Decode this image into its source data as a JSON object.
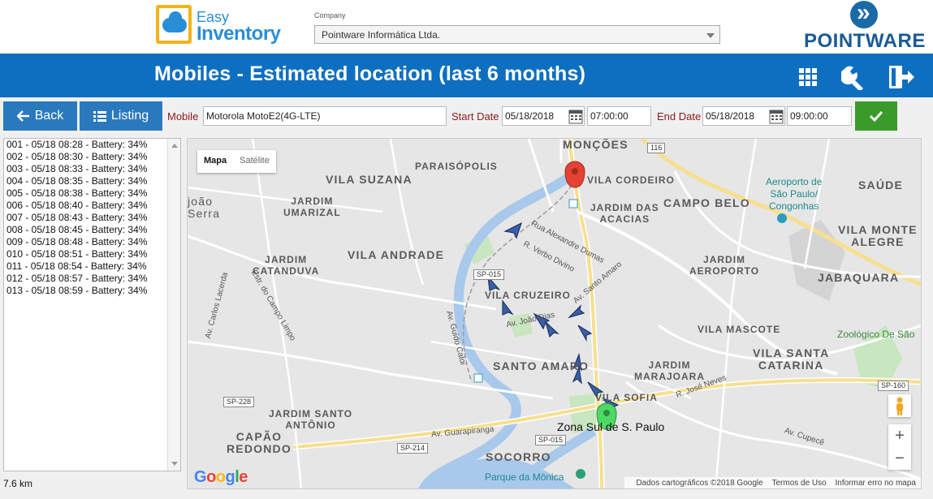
{
  "brand": {
    "app_logo_line1": "Easy",
    "app_logo_line2": "Inventory",
    "company_logo": "POINTWARE"
  },
  "company": {
    "label": "Company",
    "selected": "Pointware Informática Ltda."
  },
  "header": {
    "title": "Mobiles - Estimated location (last 6 months)",
    "icons": [
      "grid-icon",
      "wrench-icon",
      "logout-icon"
    ]
  },
  "toolbar": {
    "back_label": "Back",
    "listing_label": "Listing",
    "mobile_label": "Mobile",
    "mobile_value": "Motorola MotoE2(4G-LTE)",
    "start_date_label": "Start Date",
    "start_date": "05/18/2018",
    "start_time": "07:00:00",
    "end_date_label": "End Date",
    "end_date": "05/18/2018",
    "end_time": "09:00:00"
  },
  "readings": [
    "001 - 05/18 08:28 - Battery: 34%",
    "002 - 05/18 08:30 - Battery: 34%",
    "003 - 05/18 08:33 - Battery: 34%",
    "004 - 05/18 08:35 - Battery: 34%",
    "005 - 05/18 08:38 - Battery: 34%",
    "006 - 05/18 08:40 - Battery: 34%",
    "007 - 05/18 08:43 - Battery: 34%",
    "008 - 05/18 08:45 - Battery: 34%",
    "009 - 05/18 08:48 - Battery: 34%",
    "010 - 05/18 08:51 - Battery: 34%",
    "011 - 05/18 08:54 - Battery: 34%",
    "012 - 05/18 08:57 - Battery: 34%",
    "013 - 05/18 08:59 - Battery: 34%"
  ],
  "distance": "7.6 km",
  "map": {
    "type_map": "Mapa",
    "type_satellite": "Satélite",
    "zoom_in": "+",
    "zoom_out": "−",
    "google": "Google",
    "attribution": "Dados cartográficos ©2018 Google",
    "terms": "Termos de Uso",
    "report": "Informar erro no mapa",
    "area_label": "Zona Sul de S. Paulo",
    "places": {
      "moncoes": "MONÇÕES",
      "vila_suzana": "VILA SUZANA",
      "paraisopolis": "PARAISÓPOLIS",
      "vila_cordeiro": "VILA CORDEIRO",
      "campo_belo": "CAMPO BELO",
      "saude": "SAÚDE",
      "joao_serra": "joão\nSerra",
      "jardim_umarizal": "JARDIM\nUMARIZAL",
      "jardim_das_acacias": "JARDIM DAS\nACACIAS",
      "vila_monte_alegre": "VILA MONTE\nALEGRE",
      "aeroporto": "Aeroporto de\nSão Paulo/\nCongonhas",
      "vila_andrade": "VILA ANDRADE",
      "jardim_catanduva": "JARDIM\nCATANDUVA",
      "jardim_aeroporto": "JARDIM\nAEROPORTO",
      "jabaquara": "JABAQUARA",
      "vila_cruzeiro": "VILA CRUZEIRO",
      "vila_mascote": "VILA MASCOTE",
      "zoologico": "Zoológico De São",
      "vila_santa_catarina": "VILA SANTA\nCATARINA",
      "santo_amaro": "SANTO AMARO",
      "jardim_marajoara": "JARDIM\nMARAJOARA",
      "vila_sofia": "VILA SOFIA",
      "jardim_santo_antonio": "JARDIM SANTO\nANTÔNIO",
      "capao_redondo": "CAPÃO\nREDONDO",
      "socorro": "SOCORRO",
      "parque_da_monica": "Parque da Mônica"
    },
    "roads": {
      "sp015a": "SP-015",
      "sp015b": "SP-015",
      "sp228": "SP-228",
      "sp214": "SP-214",
      "sp160": "SP-160",
      "guarapiranga": "Av. Guarapiranga",
      "cupece": "Av. Cupecê",
      "joao_dias": "Av. João Dias",
      "alexandre_dumas": "Rua Alexandre Dumas",
      "verbo_divino": "R. Verbo Divino",
      "santo_amaro": "Av. Santo Amaro",
      "jose_neves": "R. José Neves",
      "guido_caloi": "Av. Guido Caloi",
      "carlos_lacerda": "Av. Carlos Lacerda",
      "campo_limpo": "Estr. do Campo Limpo",
      "km116": "116"
    }
  },
  "colors": {
    "primary": "#0e6fc1",
    "button": "#2a79be",
    "ok_button": "#3b9b2a",
    "label": "#8b1a1a",
    "start_marker": "#e34234",
    "end_marker": "#4cd964",
    "arrow_marker": "#3a5fa8"
  }
}
